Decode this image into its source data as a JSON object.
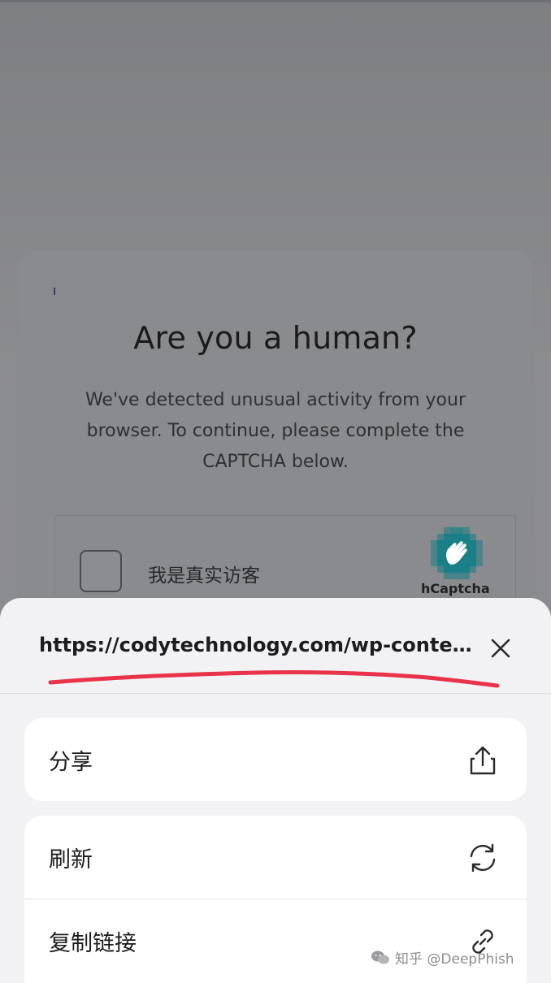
{
  "captcha": {
    "title": "Are you a human?",
    "description": "We've detected unusual activity from your browser. To continue, please complete the CAPTCHA below.",
    "checkbox_label": "我是真实访客",
    "brand": "hCaptcha"
  },
  "sheet": {
    "url": "https://codytechnology.com/wp-content/...",
    "close_icon": "close-icon",
    "actions": [
      {
        "label": "分享",
        "icon": "share-icon"
      },
      {
        "label": "刷新",
        "icon": "refresh-icon"
      },
      {
        "label": "复制链接",
        "icon": "link-icon"
      }
    ]
  },
  "watermark": {
    "text": "知乎 @DeepPhish"
  },
  "colors": {
    "annotation_red": "#e8334a",
    "hcaptcha_teal": "#1a7f87"
  }
}
